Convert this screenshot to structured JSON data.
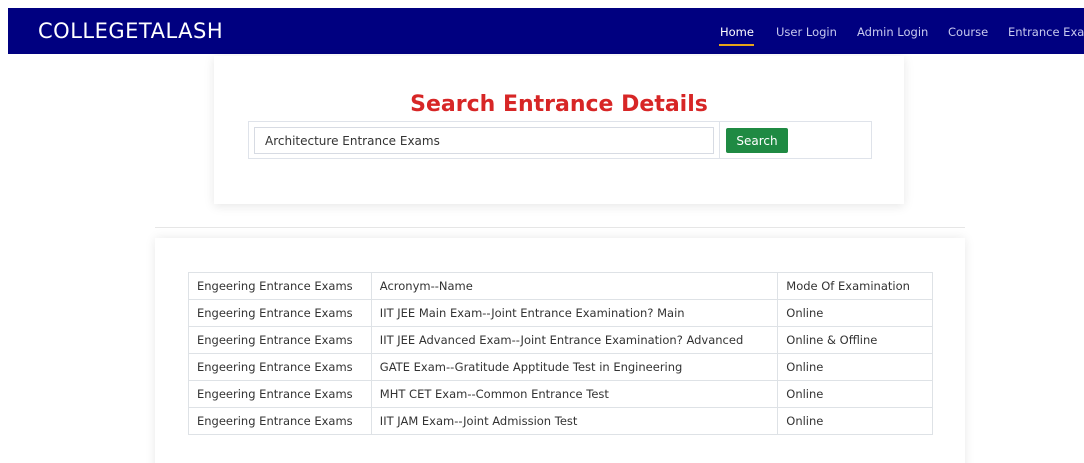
{
  "navbar": {
    "brand": "COLLEGETALASH",
    "items": [
      {
        "label": "Home",
        "active": true
      },
      {
        "label": "User Login"
      },
      {
        "label": "Admin Login"
      },
      {
        "label": "Course"
      },
      {
        "label": "Entrance Exam"
      }
    ]
  },
  "search": {
    "title": "Search Entrance Details",
    "input_value": "Architecture Entrance Exams",
    "button_label": "Search"
  },
  "table": {
    "header": [
      "Engeering Entrance Exams",
      "Acronym--Name",
      "Mode Of Examination"
    ],
    "rows": [
      [
        "Engeering Entrance Exams",
        "IIT JEE Main Exam--Joint Entrance Examination? Main",
        "Online"
      ],
      [
        "Engeering Entrance Exams",
        "IIT JEE Advanced Exam--Joint Entrance Examination? Advanced",
        "Online & Offline"
      ],
      [
        "Engeering Entrance Exams",
        "GATE Exam--Gratitude Apptitude Test in Engineering",
        "Online"
      ],
      [
        "Engeering Entrance Exams",
        "MHT CET Exam--Common Entrance Test",
        "Online"
      ],
      [
        "Engeering Entrance Exams",
        "IIT JAM Exam--Joint Admission Test",
        "Online"
      ]
    ]
  },
  "colors": {
    "navbar_bg": "#000080",
    "title_red": "#d72626",
    "button_green": "#1f8a43",
    "active_underline": "#e6a41a"
  }
}
